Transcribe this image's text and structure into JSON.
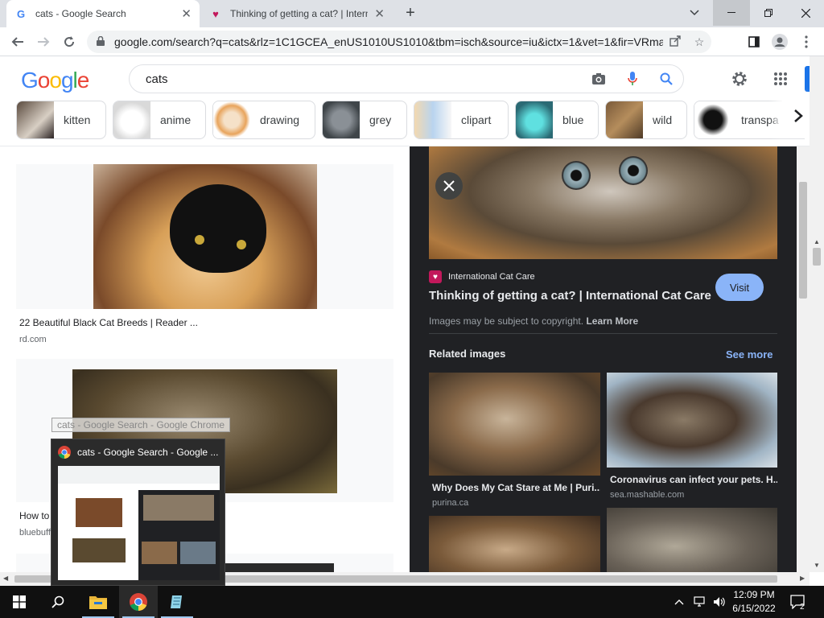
{
  "browser": {
    "tabs": [
      {
        "title": "cats - Google Search",
        "favicon": "G"
      },
      {
        "title": "Thinking of getting a cat? | Intern",
        "favicon": "♥"
      }
    ],
    "new_tab": "+",
    "url": "google.com/search?q=cats&rlz=1C1GCEA_enUS1010US1010&tbm=isch&source=iu&ictx=1&vet=1&fir=VRmao..."
  },
  "google": {
    "logo": [
      "G",
      "o",
      "o",
      "g",
      "l",
      "e"
    ],
    "query": "cats",
    "chips": [
      "kitten",
      "anime",
      "drawing",
      "grey",
      "clipart",
      "blue",
      "wild",
      "transpa"
    ]
  },
  "results": [
    {
      "caption": "22 Beautiful Black Cat Breeds | Reader ...",
      "source": "rd.com"
    },
    {
      "caption": "How to",
      "source": "bluebuff"
    }
  ],
  "panel": {
    "site_name": "International Cat Care",
    "title": "Thinking of getting a cat? | International Cat Care",
    "visit": "Visit",
    "copyright": "Images may be subject to copyright.",
    "learn_more": "Learn More",
    "related_heading": "Related images",
    "see_more": "See more",
    "related": [
      {
        "caption": "Why Does My Cat Stare at Me | Puri...",
        "source": "purina.ca"
      },
      {
        "caption": "Coronavirus can infect your pets. H...",
        "source": "sea.mashable.com"
      }
    ]
  },
  "taskbar_preview": {
    "tooltip": "cats - Google Search - Google Chrome",
    "title": "cats - Google Search - Google ..."
  },
  "clock": {
    "time": "12:09 PM",
    "date": "6/15/2022"
  },
  "notifications": "2",
  "colors": {
    "accent": "#1a73e8",
    "panel_bg": "#202124",
    "visit_btn": "#8ab4f8"
  }
}
